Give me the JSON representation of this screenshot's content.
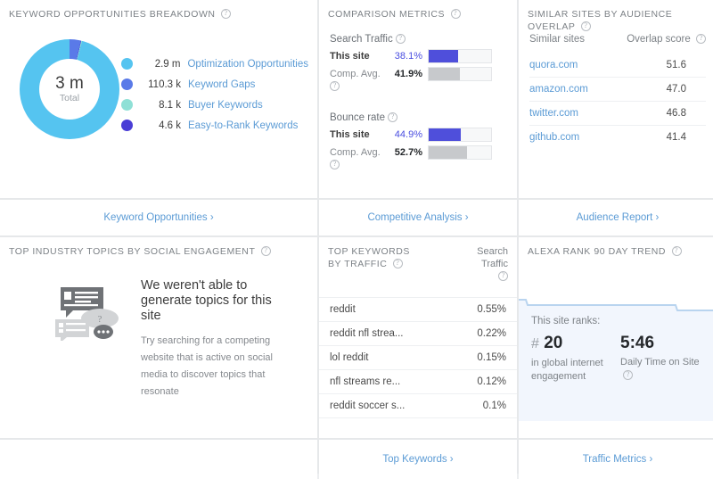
{
  "panels": {
    "keyword_opportunities": {
      "title": "KEYWORD OPPORTUNITIES BREAKDOWN",
      "help": "?",
      "donut": {
        "total_value": "3 m",
        "total_label": "Total"
      },
      "legend": [
        {
          "value": "2.9 m",
          "label": "Optimization Opportunities",
          "color": "#55c4f0"
        },
        {
          "value": "110.3 k",
          "label": "Keyword Gaps",
          "color": "#5a7ae8"
        },
        {
          "value": "8.1 k",
          "label": "Buyer Keywords",
          "color": "#8fe0d6"
        },
        {
          "value": "4.6 k",
          "label": "Easy-to-Rank Keywords",
          "color": "#4a3ed6"
        }
      ],
      "footer_link": "Keyword Opportunities ›"
    },
    "comparison_metrics": {
      "title": "COMPARISON METRICS",
      "help": "?",
      "groups": [
        {
          "name": "Search Traffic",
          "rows": [
            {
              "label": "This site",
              "value": "38.1%",
              "fill_pct": 47,
              "style": "blue"
            },
            {
              "label": "Comp. Avg.",
              "value": "41.9%",
              "fill_pct": 50,
              "style": "grey"
            }
          ]
        },
        {
          "name": "Bounce rate",
          "rows": [
            {
              "label": "This site",
              "value": "44.9%",
              "fill_pct": 52,
              "style": "blue"
            },
            {
              "label": "Comp. Avg.",
              "value": "52.7%",
              "fill_pct": 62,
              "style": "grey"
            }
          ]
        }
      ],
      "footer_link": "Competitive Analysis ›"
    },
    "similar_sites": {
      "title": "SIMILAR SITES BY AUDIENCE OVERLAP",
      "help": "?",
      "col_site": "Similar sites",
      "col_score": "Overlap score",
      "rows": [
        {
          "site": "quora.com",
          "score": "51.6"
        },
        {
          "site": "amazon.com",
          "score": "47.0"
        },
        {
          "site": "twitter.com",
          "score": "46.8"
        },
        {
          "site": "github.com",
          "score": "41.4"
        }
      ],
      "footer_link": "Audience Report ›"
    },
    "social_topics": {
      "title": "TOP INDUSTRY TOPICS BY SOCIAL ENGAGEMENT",
      "help": "?",
      "empty_title": "We weren't able to generate topics for this site",
      "empty_body": "Try searching for a competing website that is active on social media to discover topics that resonate"
    },
    "top_keywords": {
      "title_line1": "TOP KEYWORDS",
      "title_line2": "BY TRAFFIC",
      "help": "?",
      "col_right_line1": "Search",
      "col_right_line2": "Traffic",
      "rows": [
        {
          "term": "reddit",
          "value": "0.55%"
        },
        {
          "term": "reddit nfl strea...",
          "value": "0.22%"
        },
        {
          "term": "lol reddit",
          "value": "0.15%"
        },
        {
          "term": "nfl streams re...",
          "value": "0.12%"
        },
        {
          "term": "reddit soccer s...",
          "value": "0.1%"
        }
      ],
      "footer_link": "Top Keywords ›"
    },
    "alexa_rank": {
      "title": "ALEXA RANK 90 DAY TREND",
      "help": "?",
      "lead": "This site ranks:",
      "rank_hash": "#",
      "rank_value": "20",
      "rank_sub": "in global internet engagement",
      "time_value": "5:46",
      "time_sub": "Daily Time on Site",
      "footer_link": "Traffic Metrics ›",
      "trend": {
        "line_color": "#b9d4ef",
        "fill_color": "#f2f6fd",
        "points": [
          [
            0,
            14
          ],
          [
            8,
            14
          ],
          [
            10,
            20
          ],
          [
            176,
            20
          ],
          [
            178,
            26
          ],
          [
            222,
            26
          ]
        ]
      }
    }
  }
}
